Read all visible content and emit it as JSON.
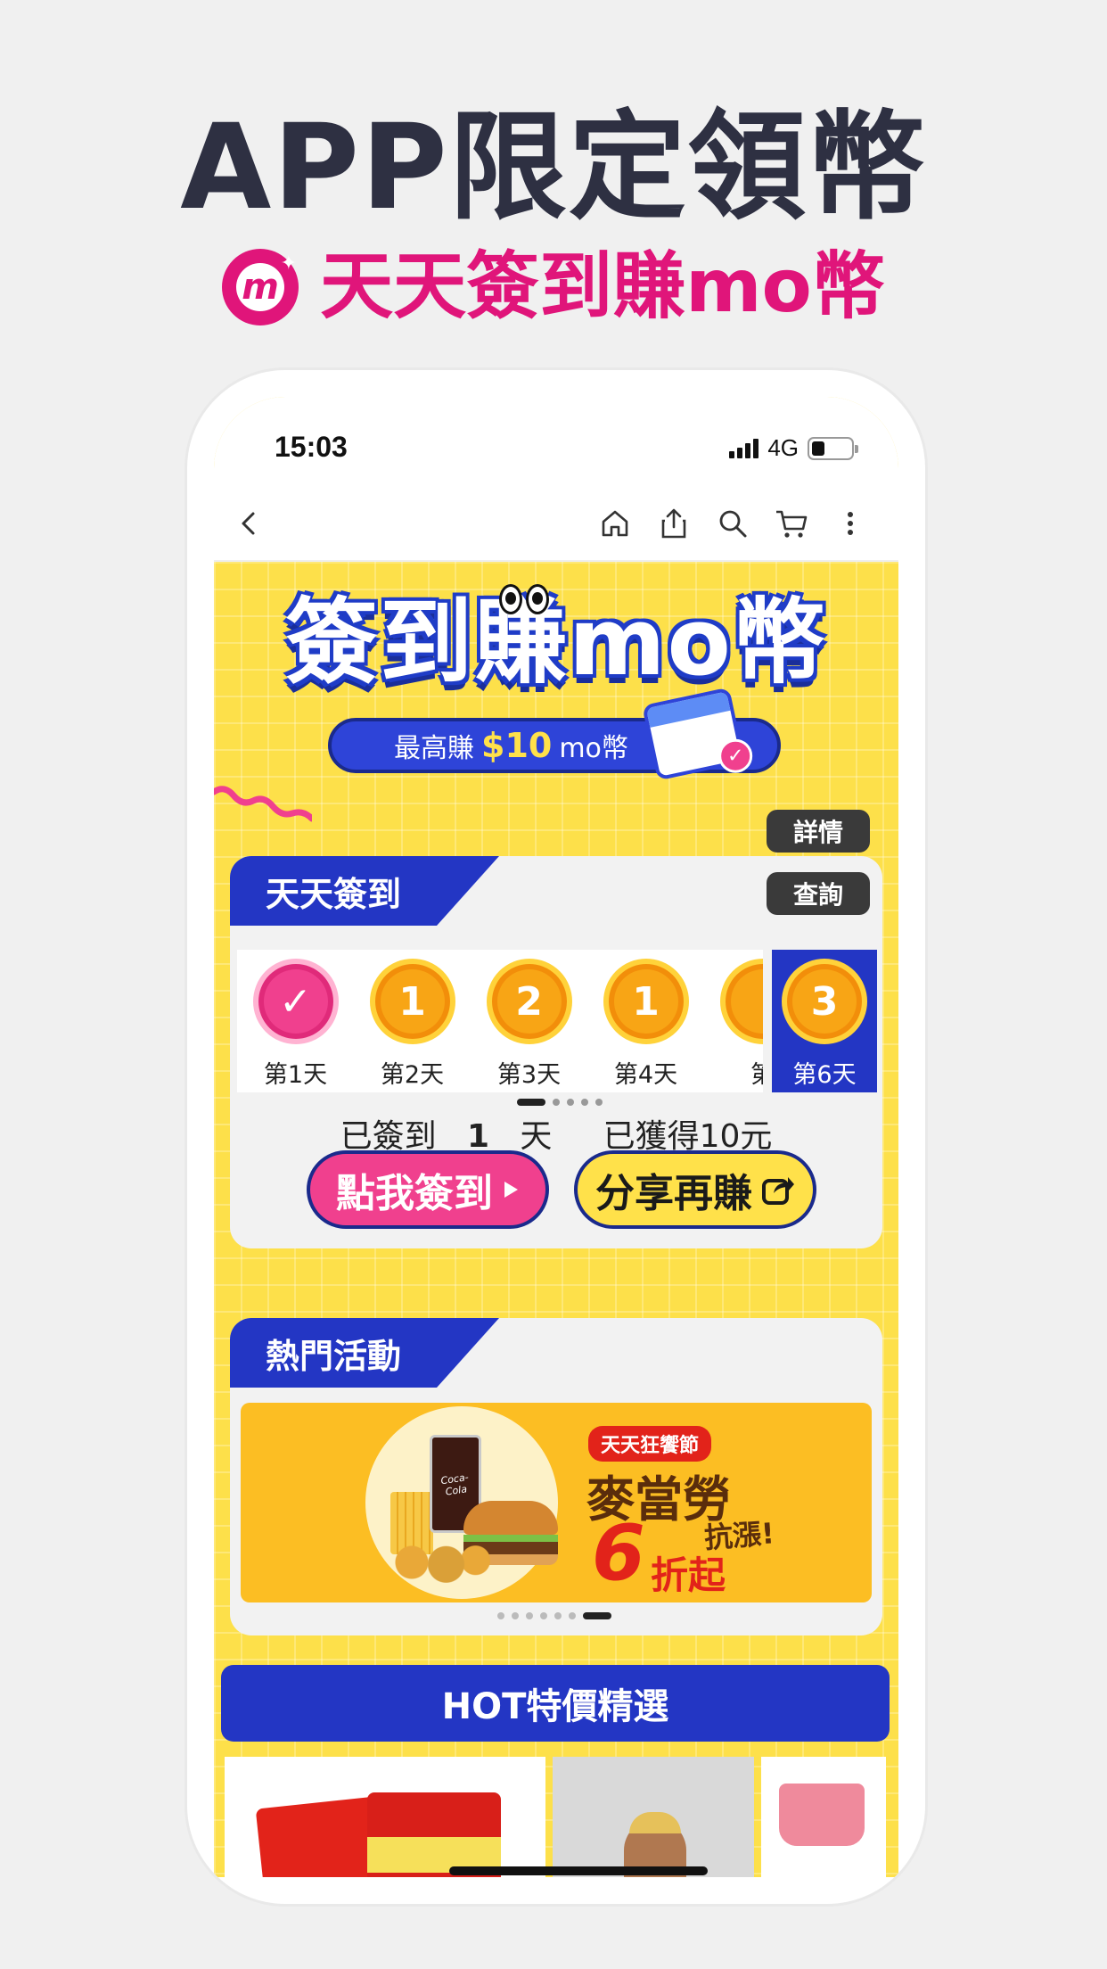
{
  "promo_header": {
    "headline": "APP限定領幣",
    "subtitle": "天天簽到賺mo幣",
    "logo_letter": "m",
    "brand_color": "#e0157a"
  },
  "status_bar": {
    "time": "15:03",
    "network": "4G",
    "battery_level": 0.3
  },
  "navbar": {
    "icons": [
      "back-icon",
      "home-icon",
      "share-icon",
      "search-icon",
      "cart-icon",
      "more-icon"
    ]
  },
  "banner": {
    "title": "簽到賺mo幣",
    "pill_prefix": "最高賺",
    "pill_amount": "$10",
    "pill_suffix": "mo幣",
    "accent_color": "#2336c4"
  },
  "side_buttons": {
    "details": "詳情",
    "query": "查詢"
  },
  "checkin": {
    "title": "天天簽到",
    "days": [
      {
        "label": "第1天",
        "coin": "✓",
        "done": true
      },
      {
        "label": "第2天",
        "coin": "1",
        "done": false
      },
      {
        "label": "第3天",
        "coin": "2",
        "done": false
      },
      {
        "label": "第4天",
        "coin": "1",
        "done": false
      },
      {
        "label": "第",
        "coin": "",
        "done": false
      }
    ],
    "day6": {
      "label": "第6天",
      "coin": "3"
    },
    "summary_signed": "已簽到",
    "summary_count": "1",
    "summary_day": "天",
    "summary_earned": "已獲得10元",
    "checkin_button": "點我簽到",
    "share_button": "分享再賺"
  },
  "hot_events": {
    "title": "熱門活動",
    "promo_tag": "天天狂饗節",
    "promo_title": "麥當勞",
    "promo_anti": "抗漲!",
    "promo_big": "6",
    "promo_discount": "折起"
  },
  "hot_deals": {
    "title": "HOT特價精選"
  }
}
